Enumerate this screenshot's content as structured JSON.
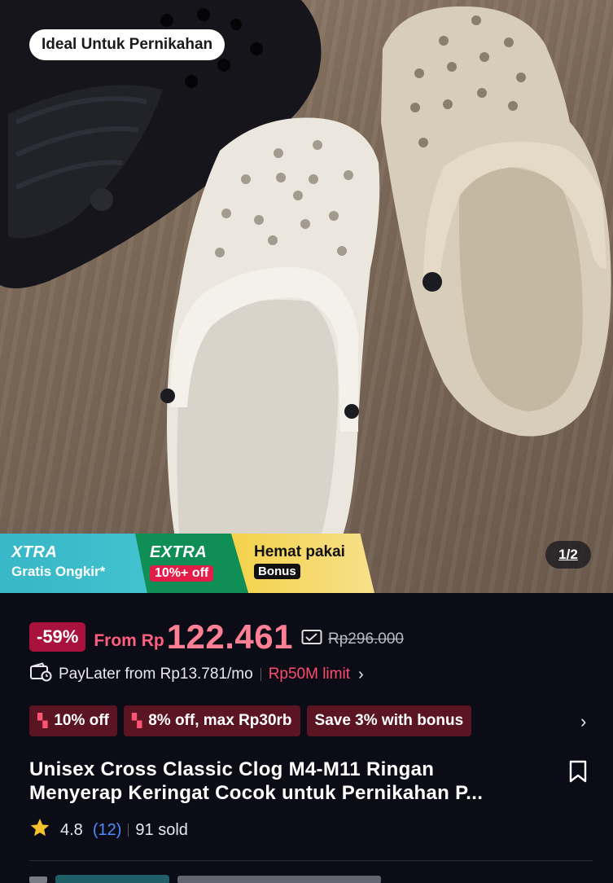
{
  "gallery": {
    "tag": "Ideal Untuk Pernikahan",
    "counter": "1/2",
    "promo": {
      "xtra_title": "XTRA",
      "xtra_sub": "Gratis Ongkir*",
      "extra_title": "EXTRA",
      "extra_chip": "10%+ off",
      "hemat_title": "Hemat pakai",
      "hemat_chip": "Bonus"
    }
  },
  "price": {
    "discount": "-59%",
    "from": "From Rp",
    "amount": "122.461",
    "original": "Rp296.000"
  },
  "paylater": {
    "text": "PayLater from Rp13.781/mo",
    "limit": "Rp50M limit"
  },
  "coupons": [
    {
      "label": "10% off"
    },
    {
      "label": "8% off, max Rp30rb"
    },
    {
      "label": "Save 3% with bonus"
    }
  ],
  "product": {
    "title_line1": "Unisex Cross Classic Clog M4-M11 Ringan",
    "title_line2": "Menyerap Keringat Cocok untuk Pernikahan P..."
  },
  "rating": {
    "score": "4.8",
    "count": "(12)",
    "sold": "91 sold"
  },
  "colors": {
    "accent_price": "#ff8095",
    "limit_red": "#ff4b6e",
    "discount_badge": "#a8123c",
    "coupon_bg": "#5a1422",
    "rating_count_blue": "#4c8dff",
    "star": "#f6c32c"
  }
}
